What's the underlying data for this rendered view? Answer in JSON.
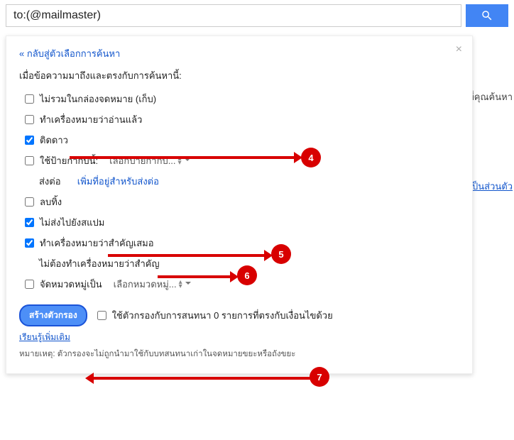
{
  "search": {
    "value": "to:(@mailmaster)"
  },
  "panel": {
    "back": "« กลับสู่ตัวเลือกการค้นหา",
    "heading": "เมื่อข้อความมาถึงและตรงกับการค้นหานี้:",
    "options": {
      "skip_inbox": "ไม่รวมในกล่องจดหมาย (เก็บ)",
      "mark_read": "ทำเครื่องหมายว่าอ่านแล้ว",
      "star": "ติดดาว",
      "apply_label": "ใช้ป้ายกำกับนี้:",
      "label_dd": "เลือกป้ายกำกับ...",
      "forward_prefix": "ส่งต่อ",
      "add_fwd": "เพิ่มที่อยู่สำหรับส่งต่อ",
      "delete": "ลบทิ้ง",
      "never_spam": "ไม่ส่งไปยังสแปม",
      "always_important": "ทำเครื่องหมายว่าสำคัญเสมอ",
      "never_important": "ไม่ต้องทำเครื่องหมายว่าสำคัญ",
      "categorize": "จัดหมวดหมู่เป็น",
      "category_dd": "เลือกหมวดหมู่..."
    },
    "create_btn": "สร้างตัวกรอง",
    "apply_existing_prefix": "ใช้ตัวกรองกับการสนทนา ",
    "apply_existing_count": "0",
    "apply_existing_suffix": " รายการที่ตรงกับเงื่อนไขด้วย",
    "learn_more": "เรียนรู้เพิ่มเติม",
    "note": "หมายเหตุ: ตัวกรองจะไม่ถูกนำมาใช้กับบทสนทนาเก่าในจดหมายขยะหรือถังขยะ"
  },
  "background": {
    "line1": "เกณฑ์ที่คุณค้นหา",
    "line2": "มเป็นส่วนตัว"
  },
  "callouts": {
    "c4": "4",
    "c5": "5",
    "c6": "6",
    "c7": "7"
  }
}
